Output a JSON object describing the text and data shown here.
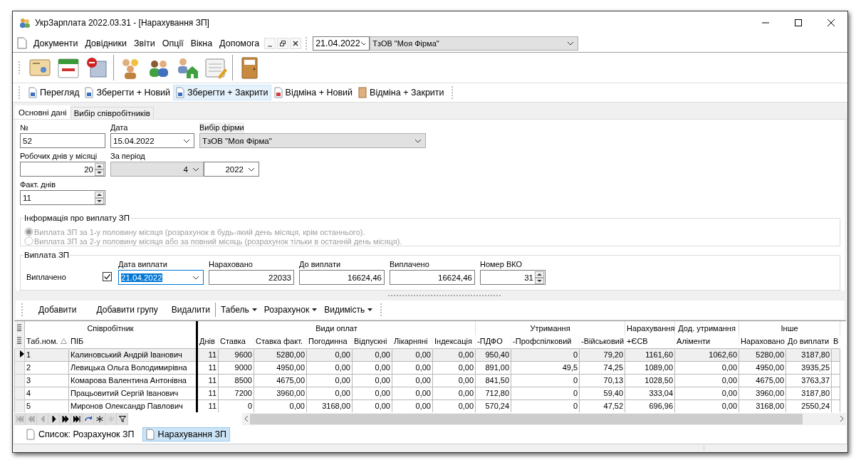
{
  "window": {
    "title": "УкрЗарплата 2022.03.31 - [Нарахування ЗП]"
  },
  "menu": [
    "Документи",
    "Довідники",
    "Звіти",
    "Опції",
    "Вікна",
    "Допомога"
  ],
  "date_select": {
    "value": "21.04.2022"
  },
  "firm_select": {
    "value": "ТзОВ \"Моя Фірма\""
  },
  "actions": [
    {
      "label": "Перегляд",
      "selected": false
    },
    {
      "label": "Зберегти + Новий",
      "selected": false
    },
    {
      "label": "Зберегти + Закрити",
      "selected": true
    },
    {
      "label": "Відміна + Новий",
      "selected": false
    },
    {
      "label": "Відміна + Закрити",
      "selected": false
    }
  ],
  "tabs": [
    {
      "label": "Основні дані",
      "selected": true
    },
    {
      "label": "Вибір співробітників",
      "selected": false
    }
  ],
  "form": {
    "number": {
      "label": "№",
      "value": "52"
    },
    "date": {
      "label": "Дата",
      "value": "15.04.2022"
    },
    "firm": {
      "label": "Вибір фірми",
      "value": "ТзОВ \"Моя Фірма\""
    },
    "work_days": {
      "label": "Робочих днів у місяці",
      "value": "20"
    },
    "period": {
      "label": "За період",
      "month": "4",
      "year": "2022"
    },
    "fact_days": {
      "label": "Факт. днів",
      "value": "11"
    }
  },
  "payment_info": {
    "title": "Інформація про виплату ЗП",
    "disabled": true,
    "options": [
      {
        "label": "Виплата ЗП за 1-у половину місяця (розрахунок в будь-який день місяця, крім останнього).",
        "selected": true
      },
      {
        "label": "Виплата ЗП за 2-у половину місяця або за повний місяць (розрахунок тільки в останній день місяця).",
        "selected": false
      }
    ]
  },
  "payout": {
    "title": "Виплата ЗП",
    "paid_label": "Виплачено",
    "paid_checked": true,
    "fields": [
      {
        "kind": "date",
        "label": "Дата виплати",
        "value": "21.04.2022",
        "focused": true
      },
      {
        "kind": "text",
        "label": "Нараховано",
        "value": "22033"
      },
      {
        "kind": "text",
        "label": "До виплати",
        "value": "16624,46"
      },
      {
        "kind": "text",
        "label": "Виплачено",
        "value": "16624,46"
      },
      {
        "kind": "spin",
        "label": "Номер ВКО",
        "value": "31"
      }
    ]
  },
  "grid_toolbar": [
    {
      "kind": "button",
      "label": "Добавити"
    },
    {
      "kind": "button",
      "label": "Добавити групу"
    },
    {
      "kind": "button",
      "label": "Видалити"
    },
    {
      "kind": "menu",
      "label": "Табель"
    },
    {
      "kind": "menu",
      "label": "Розрахунок"
    },
    {
      "kind": "menu",
      "label": "Видимість"
    }
  ],
  "table": {
    "groups": [
      "Співробітник",
      "Види оплат",
      "Утримання",
      "Нарахування",
      "Дод. утримання",
      "Інше"
    ],
    "columns": [
      "Таб.ном.",
      "ПІБ",
      "Днів",
      "Ставка",
      "Ставка факт.",
      "Погодинна",
      "Відпускні",
      "Лікарняні",
      "Індексація",
      "-ПДФО",
      "-Профспілковий",
      "-Військовий",
      "+ЄСВ",
      "Аліменти",
      "Нараховано",
      "До виплати",
      "В"
    ],
    "rows": [
      {
        "selected": true,
        "cells": [
          "1",
          "Калиновський Андрій Іванович",
          "11",
          "9600",
          "5280,00",
          "0,00",
          "0,00",
          "0,00",
          "0,00",
          "950,40",
          "0",
          "79,20",
          "1161,60",
          "1062,60",
          "5280,00",
          "3187,80"
        ]
      },
      {
        "selected": false,
        "cells": [
          "2",
          "Левицька Ольга Володимирівна",
          "11",
          "9000",
          "4950,00",
          "0,00",
          "0,00",
          "0,00",
          "0,00",
          "891,00",
          "49,5",
          "74,25",
          "1089,00",
          "0,00",
          "4950,00",
          "3935,25"
        ]
      },
      {
        "selected": false,
        "cells": [
          "3",
          "Комарова Валентина Антонівна",
          "11",
          "8500",
          "4675,00",
          "0,00",
          "0,00",
          "0,00",
          "0,00",
          "841,50",
          "0",
          "70,13",
          "1028,50",
          "0,00",
          "4675,00",
          "3763,37"
        ]
      },
      {
        "selected": false,
        "cells": [
          "4",
          "Працьовитий Сергій Іванович",
          "11",
          "7200",
          "3960,00",
          "0,00",
          "0,00",
          "0,00",
          "0,00",
          "712,80",
          "0",
          "59,40",
          "333,04",
          "0,00",
          "3960,00",
          "3187,80"
        ]
      },
      {
        "selected": false,
        "cells": [
          "5",
          "Миронов Олександр Павлович",
          "11",
          "0",
          "0,00",
          "3168,00",
          "0,00",
          "0,00",
          "0,00",
          "570,24",
          "0",
          "47,52",
          "696,96",
          "0,00",
          "3168,00",
          "2550,24"
        ]
      }
    ]
  },
  "doc_tabs": [
    {
      "label": "Список: Розрахунок ЗП",
      "selected": false
    },
    {
      "label": "Нарахування ЗП",
      "selected": true
    }
  ]
}
